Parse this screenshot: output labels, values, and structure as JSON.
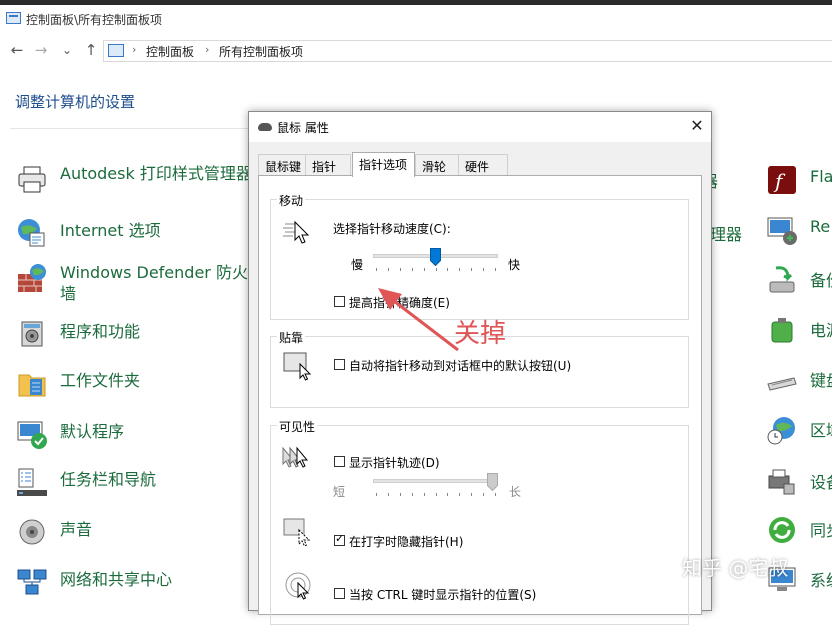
{
  "window": {
    "title": "控制面板\\所有控制面板项"
  },
  "breadcrumb": {
    "items": [
      "控制面板",
      "所有控制面板项"
    ],
    "separator": "›"
  },
  "nav": {
    "back": "←",
    "forward": "→",
    "dropdown": "⌄",
    "up": "↑"
  },
  "page": {
    "title": "调整计算机的设置"
  },
  "left_items": [
    {
      "label": "Autodesk 打印样式管理器",
      "icon": "printer-icon"
    },
    {
      "label": "Internet 选项",
      "icon": "internet-options-icon"
    },
    {
      "label": "Windows Defender 防火墙",
      "icon": "firewall-icon"
    },
    {
      "label": "程序和功能",
      "icon": "programs-icon"
    },
    {
      "label": "工作文件夹",
      "icon": "work-folders-icon"
    },
    {
      "label": "默认程序",
      "icon": "default-programs-icon"
    },
    {
      "label": "任务栏和导航",
      "icon": "taskbar-icon"
    },
    {
      "label": "声音",
      "icon": "sound-icon"
    },
    {
      "label": "网络和共享中心",
      "icon": "network-icon"
    }
  ],
  "mid_fragments": [
    "器",
    "理器"
  ],
  "right_items": [
    {
      "label": "Fla",
      "icon": "flash-icon"
    },
    {
      "label": "Re",
      "icon": "remote-icon"
    },
    {
      "label": "备份",
      "icon": "backup-icon"
    },
    {
      "label": "电源",
      "icon": "power-icon"
    },
    {
      "label": "键盘",
      "icon": "keyboard-icon"
    },
    {
      "label": "区域",
      "icon": "region-icon"
    },
    {
      "label": "设备",
      "icon": "devices-icon"
    },
    {
      "label": "同步",
      "icon": "sync-icon"
    },
    {
      "label": "系统",
      "icon": "system-icon"
    }
  ],
  "dialog": {
    "title": "鼠标 属性",
    "close": "✕",
    "tabs": [
      "鼠标键",
      "指针",
      "指针选项",
      "滑轮",
      "硬件"
    ],
    "active_tab": "指针选项",
    "motion": {
      "heading": "移动",
      "speed_label": "选择指针移动速度(C):",
      "slow": "慢",
      "fast": "快",
      "speed_level": 0.5,
      "precision_label": "提高指针精确度(E)",
      "precision_checked": false
    },
    "snap": {
      "heading": "贴靠",
      "label": "自动将指针移动到对话框中的默认按钮(U)",
      "checked": false
    },
    "visibility": {
      "heading": "可见性",
      "trails_label": "显示指针轨迹(D)",
      "trails_checked": false,
      "short": "短",
      "long": "长",
      "trail_level": 1.0,
      "hide_label": "在打字时隐藏指针(H)",
      "hide_checked": true,
      "ctrl_label": "当按 CTRL 键时显示指针的位置(S)",
      "ctrl_checked": false
    }
  },
  "annotation": {
    "text": "关掉",
    "color": "#e05656"
  },
  "watermark": {
    "text": "知乎 @宅叔"
  }
}
